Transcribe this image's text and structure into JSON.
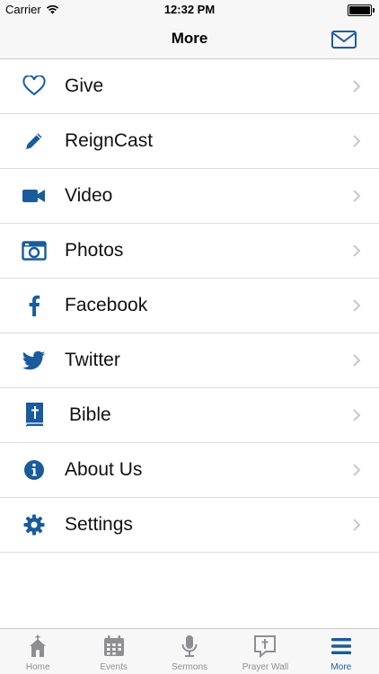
{
  "status_bar": {
    "carrier": "Carrier",
    "time": "12:32 PM"
  },
  "nav": {
    "title": "More",
    "right_icon": "mail-icon"
  },
  "menu": {
    "items": [
      {
        "label": "Give",
        "icon": "heart-icon"
      },
      {
        "label": "ReignCast",
        "icon": "pencil-icon"
      },
      {
        "label": "Video",
        "icon": "video-camera-icon"
      },
      {
        "label": "Photos",
        "icon": "photo-camera-icon"
      },
      {
        "label": "Facebook",
        "icon": "facebook-icon"
      },
      {
        "label": "Twitter",
        "icon": "twitter-icon"
      },
      {
        "label": "Bible",
        "icon": "bible-icon"
      },
      {
        "label": "About Us",
        "icon": "info-icon"
      },
      {
        "label": "Settings",
        "icon": "gear-icon"
      }
    ]
  },
  "tabs": [
    {
      "label": "Home",
      "icon": "church-icon"
    },
    {
      "label": "Events",
      "icon": "calendar-icon"
    },
    {
      "label": "Sermons",
      "icon": "microphone-icon"
    },
    {
      "label": "Prayer Wall",
      "icon": "prayer-bubble-icon"
    },
    {
      "label": "More",
      "icon": "menu-icon",
      "active": true
    }
  ],
  "colors": {
    "accent": "#1a5b9c",
    "inactive": "#8e8e93",
    "separator": "#dcdcdf",
    "bar_background": "#f7f7f7"
  }
}
